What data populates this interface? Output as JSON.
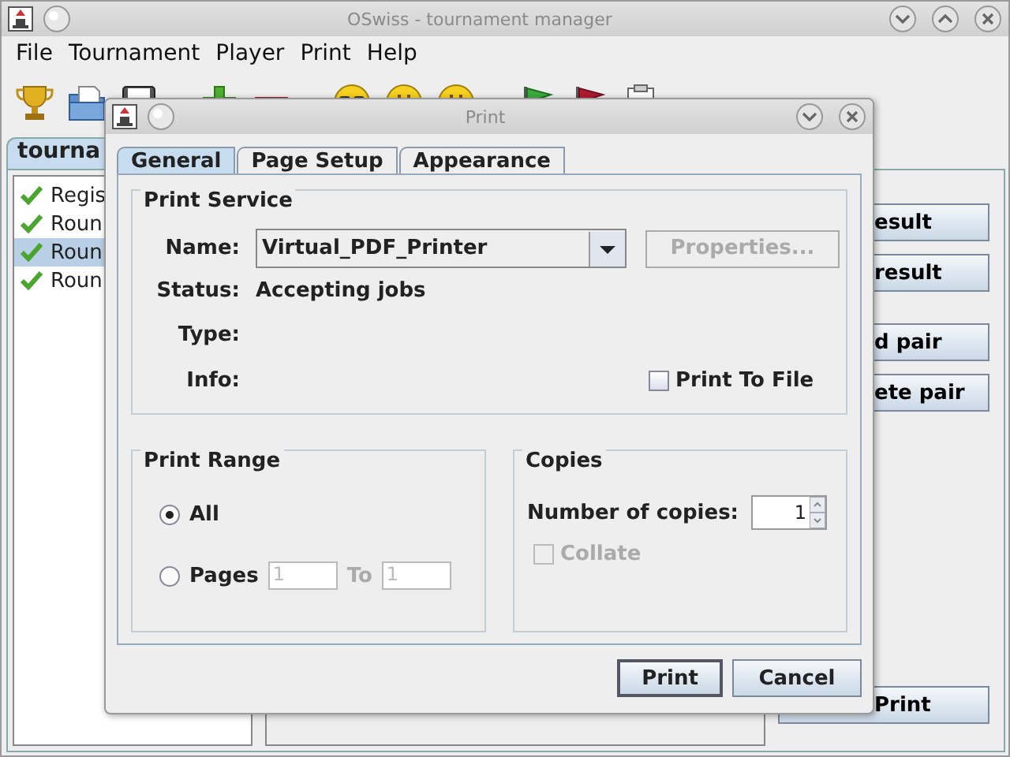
{
  "window": {
    "title": "OSwiss - tournament manager"
  },
  "menu": [
    {
      "label": "File"
    },
    {
      "label": "Tournament"
    },
    {
      "label": "Player"
    },
    {
      "label": "Print"
    },
    {
      "label": "Help"
    }
  ],
  "tab": {
    "label": "tourna",
    "selected": true
  },
  "rounds": [
    {
      "label": "Regis",
      "done": true,
      "selected": false
    },
    {
      "label": "Roun",
      "done": true,
      "selected": false
    },
    {
      "label": "Roun",
      "done": true,
      "selected": true
    },
    {
      "label": "Roun",
      "done": true,
      "selected": false
    }
  ],
  "side_buttons": [
    "esult",
    "result",
    "d pair",
    "ete pair",
    "Print"
  ],
  "dialog": {
    "title": "Print",
    "tabs": [
      {
        "label": "General",
        "selected": true
      },
      {
        "label": "Page Setup",
        "selected": false
      },
      {
        "label": "Appearance",
        "selected": false
      }
    ],
    "print_service": {
      "title": "Print Service",
      "name_label": "Name:",
      "printer": "Virtual_PDF_Printer",
      "properties": {
        "label": "Properties...",
        "disabled": true
      },
      "status_label": "Status:",
      "status": "Accepting jobs",
      "type_label": "Type:",
      "info_label": "Info:",
      "print_to_file": {
        "label": "Print To File",
        "checked": false
      }
    },
    "print_range": {
      "title": "Print Range",
      "options": [
        {
          "label": "All",
          "selected": true
        },
        {
          "label": "Pages",
          "selected": false
        }
      ],
      "from": "1",
      "to_label": "To",
      "to": "1"
    },
    "copies": {
      "title": "Copies",
      "label": "Number of copies:",
      "value": "1",
      "collate": {
        "label": "Collate",
        "checked": false,
        "disabled": true
      }
    },
    "buttons": [
      "Print",
      "Cancel"
    ]
  }
}
